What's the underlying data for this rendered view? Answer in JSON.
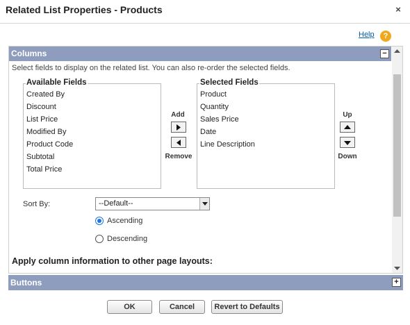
{
  "dialog": {
    "title": "Related List Properties - Products",
    "close_symbol": "×"
  },
  "help": {
    "label": "Help",
    "icon_symbol": "?",
    "icon": "help-icon"
  },
  "columns_section": {
    "title": "Columns",
    "toggle_symbol": "−",
    "instructions": "Select fields to display on the related list. You can also re-order the selected fields.",
    "available": {
      "label": "Available Fields",
      "items": [
        "Created By",
        "Discount",
        "List Price",
        "Modified By",
        "Product Code",
        "Subtotal",
        "Total Price"
      ]
    },
    "selected": {
      "label": "Selected Fields",
      "items": [
        "Product",
        "Quantity",
        "Sales Price",
        "Date",
        "Line Description"
      ]
    },
    "add_label": "Add",
    "remove_label": "Remove",
    "up_label": "Up",
    "down_label": "Down",
    "sort_by_label": "Sort By:",
    "sort_by_value": "--Default--",
    "ascending_label": "Ascending",
    "descending_label": "Descending",
    "sort_order_selected": "Ascending",
    "apply_text": "Apply column information to other page layouts:"
  },
  "buttons_section": {
    "title": "Buttons",
    "toggle_symbol": "+"
  },
  "footer": {
    "ok_label": "OK",
    "cancel_label": "Cancel",
    "revert_label": "Revert to Defaults"
  },
  "colors": {
    "section_header": "#8e9dbe",
    "link": "#015ba7",
    "help_icon": "#f0a81c"
  }
}
